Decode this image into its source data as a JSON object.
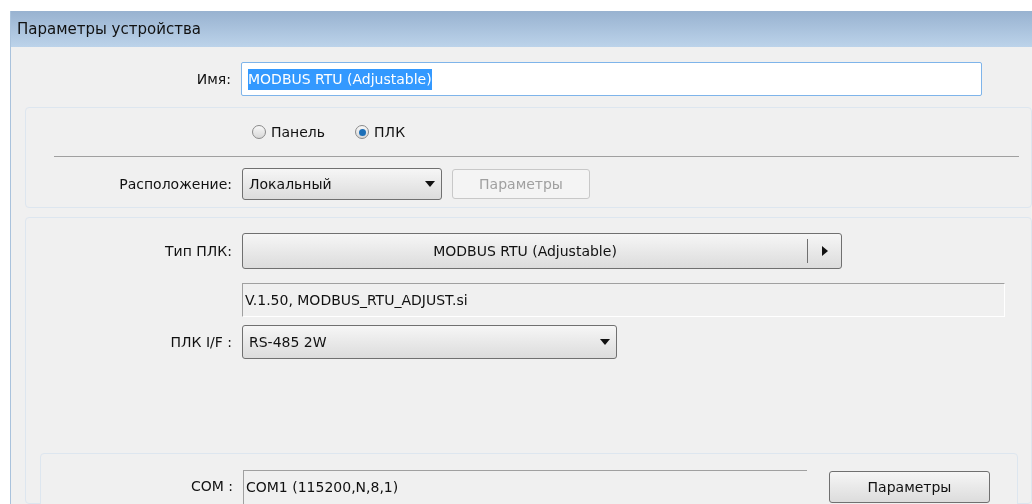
{
  "window": {
    "title": "Параметры устройства"
  },
  "name_field": {
    "label": "Имя:",
    "value": "MODBUS RTU (Adjustable)",
    "selected": true
  },
  "device_types": [
    {
      "label": "Панель",
      "selected": false
    },
    {
      "label": "ПЛК",
      "selected": true
    }
  ],
  "location": {
    "label": "Расположение:",
    "value": "Локальный"
  },
  "location_button": {
    "label": "Параметры",
    "disabled": true
  },
  "plc_type": {
    "label": "Тип ПЛК:",
    "value": "MODBUS RTU (Adjustable)"
  },
  "plc_info": {
    "value": "V.1.50, MODBUS_RTU_ADJUST.si"
  },
  "plc_if": {
    "label": "ПЛК I/F :",
    "value": "RS-485 2W"
  },
  "com": {
    "label": "COM :",
    "value": "COM1 (115200,N,8,1)"
  },
  "com_button": {
    "label": "Параметры",
    "disabled": false
  }
}
